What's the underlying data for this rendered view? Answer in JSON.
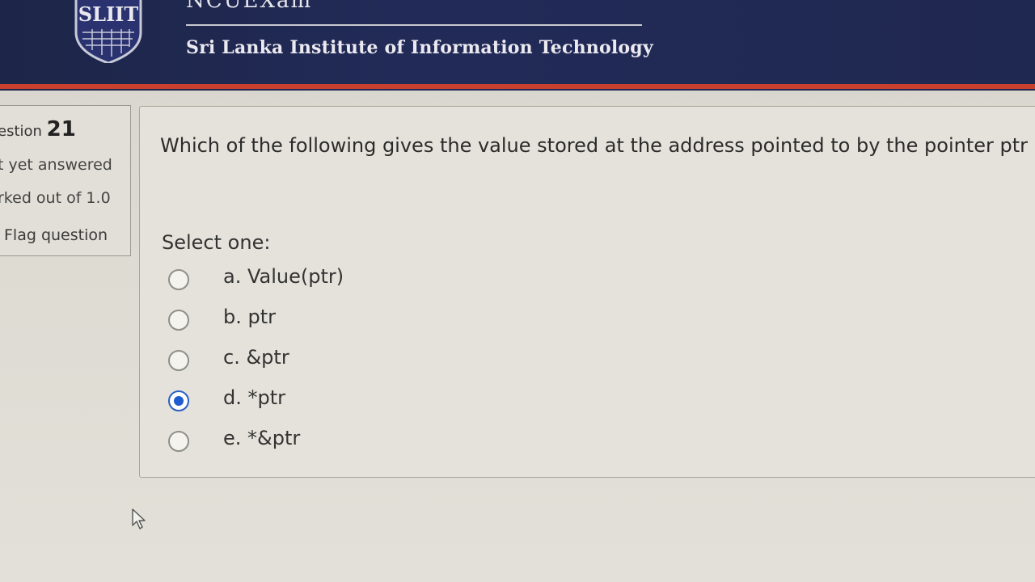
{
  "header": {
    "logo_text": "SLIIT",
    "top_banner_text": "NCUEXam",
    "institute_name": "Sri Lanka Institute of Information Technology",
    "colors": {
      "background": "#1f2850",
      "accent": "#c9412e"
    }
  },
  "question_info": {
    "label": "estion",
    "number": "21",
    "state": "t yet answered",
    "marks": "rked out of 1.0",
    "flag_label": "Flag question"
  },
  "question": {
    "text": "Which of the following gives the value stored at the address pointed to by the pointer ptr ?",
    "prompt": "Select one:",
    "options": [
      {
        "label": "a. Value(ptr)",
        "selected": false
      },
      {
        "label": "b. ptr",
        "selected": false
      },
      {
        "label": "c. &ptr",
        "selected": false
      },
      {
        "label": "d. *ptr",
        "selected": true
      },
      {
        "label": "e. *&ptr",
        "selected": false
      }
    ]
  },
  "icons": {
    "cursor": "mouse-pointer-icon",
    "logo": "sliit-shield-logo"
  }
}
